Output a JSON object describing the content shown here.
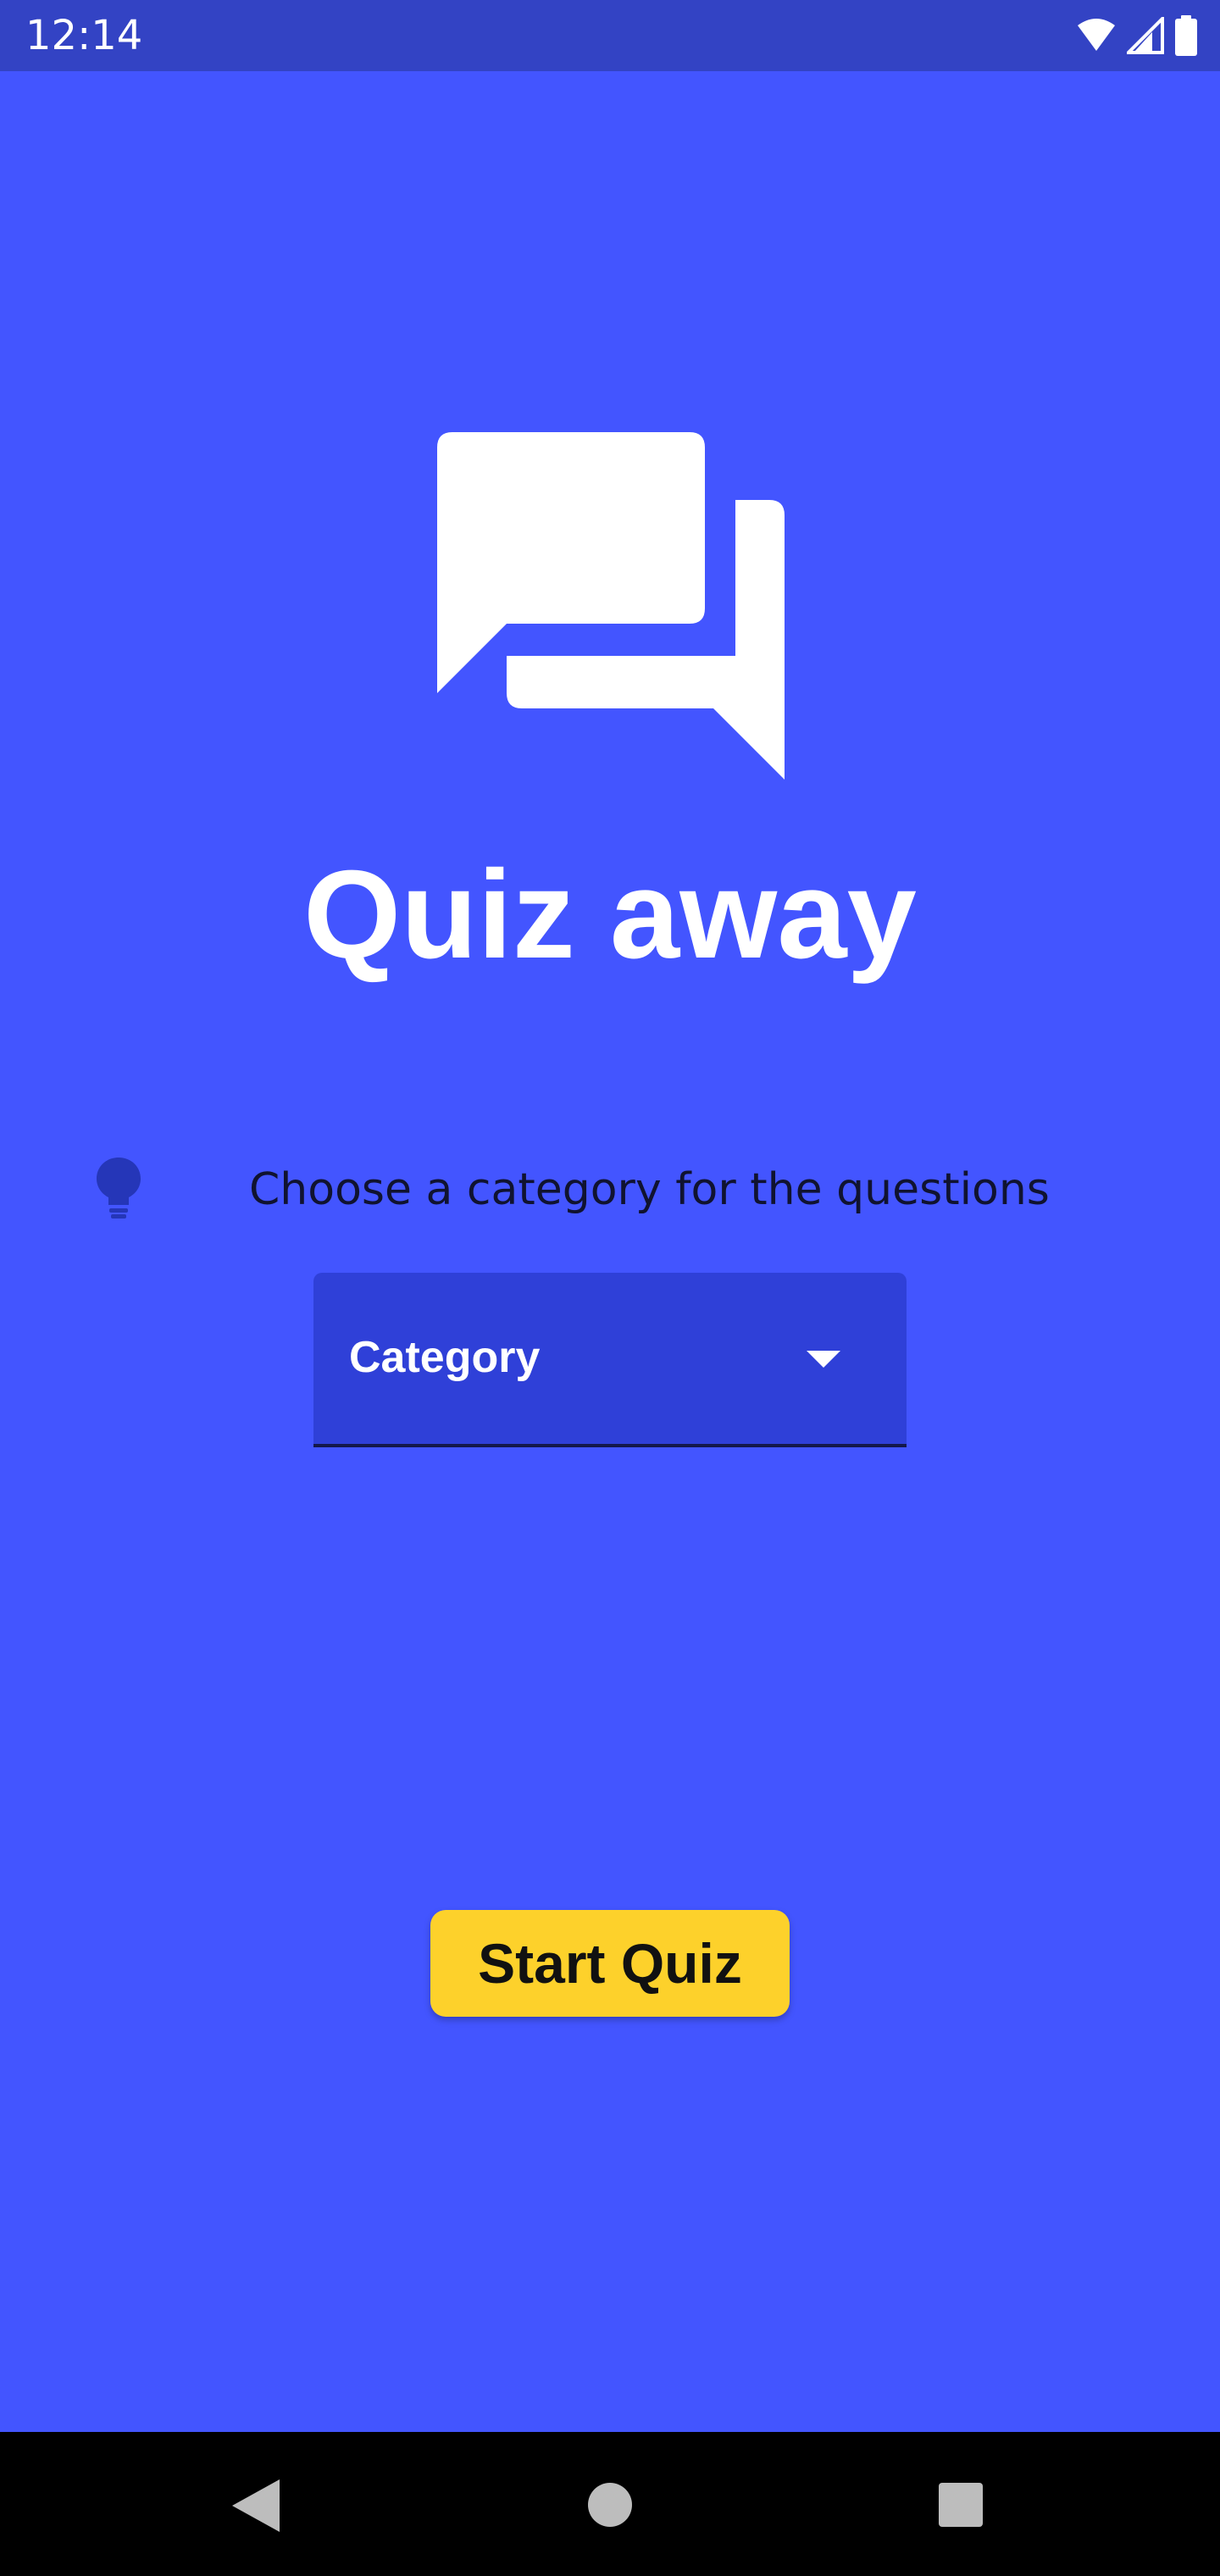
{
  "status_bar": {
    "time": "12:14",
    "icons": [
      "wifi-icon",
      "cell-signal-icon",
      "battery-icon"
    ]
  },
  "app": {
    "logo_icon": "chat-bubbles-icon",
    "title": "Quiz away"
  },
  "category": {
    "hint_icon": "lightbulb-icon",
    "hint_text": "Choose a category for the questions",
    "dropdown_label": "Category"
  },
  "actions": {
    "start_label": "Start Quiz"
  },
  "nav_bar": {
    "buttons": [
      "back-icon",
      "home-icon",
      "recents-icon"
    ]
  },
  "colors": {
    "background": "#4355ff",
    "status_bar": "#3343c4",
    "dropdown": "#2f40d8",
    "button": "#fdd12b",
    "hint_icon": "#2536b8"
  }
}
